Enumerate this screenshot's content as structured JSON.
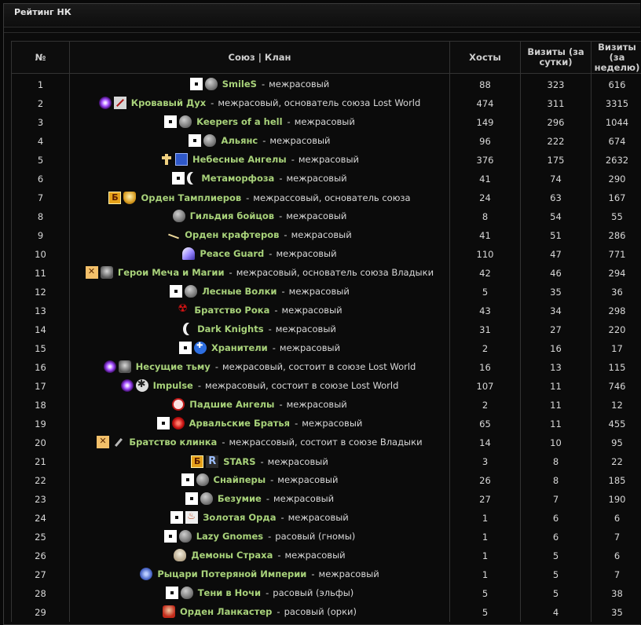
{
  "window": {
    "title": "Рейтинг НК"
  },
  "table": {
    "headers": {
      "num": "№",
      "clan": "Союз | Клан",
      "hosts": "Хосты",
      "visits_day": "Визиты (за сутки)",
      "visits_week": "Визиты (за неделю)"
    },
    "rows": [
      {
        "num": "1",
        "badges": [
          "white-square-icon",
          "stone-icon"
        ],
        "name": "SmileS",
        "desc": "межрасовый",
        "hosts": "88",
        "day": "323",
        "week": "616"
      },
      {
        "num": "2",
        "badges": [
          "purple-orb-icon",
          "sword-icon"
        ],
        "name": "Кровавый Дух",
        "desc": "межрасовый, основатель союза Lost World",
        "hosts": "474",
        "day": "311",
        "week": "3315"
      },
      {
        "num": "3",
        "badges": [
          "white-square-icon",
          "stone-icon"
        ],
        "name": "Keepers of a hell",
        "desc": "межрасовый",
        "hosts": "149",
        "day": "296",
        "week": "1044"
      },
      {
        "num": "4",
        "badges": [
          "white-square-icon",
          "stone-icon"
        ],
        "name": "Альянс",
        "desc": "межрасовый",
        "hosts": "96",
        "day": "222",
        "week": "674"
      },
      {
        "num": "5",
        "badges": [
          "cross-icon",
          "blue-emblem-icon"
        ],
        "name": "Небесные Ангелы",
        "desc": "межрасовый",
        "hosts": "376",
        "day": "175",
        "week": "2632"
      },
      {
        "num": "6",
        "badges": [
          "white-square-icon",
          "moon-icon"
        ],
        "name": "Метаморфоза",
        "desc": "межрасовый",
        "hosts": "41",
        "day": "74",
        "week": "290"
      },
      {
        "num": "7",
        "badges": [
          "gold-b-icon",
          "shield-icon"
        ],
        "name": "Орден Тамплиеров",
        "desc": "межрассовый, основатель союза",
        "hosts": "24",
        "day": "63",
        "week": "167"
      },
      {
        "num": "8",
        "badges": [
          "stone-icon"
        ],
        "name": "Гильдия бойцов",
        "desc": "межрасовый",
        "hosts": "8",
        "day": "54",
        "week": "55"
      },
      {
        "num": "9",
        "badges": [
          "blade-icon"
        ],
        "name": "Орден крафтеров",
        "desc": "межрасовый",
        "hosts": "41",
        "day": "51",
        "week": "286"
      },
      {
        "num": "10",
        "badges": [
          "wing-icon"
        ],
        "name": "Peace Guard",
        "desc": "межрасовый",
        "hosts": "110",
        "day": "47",
        "week": "771"
      },
      {
        "num": "11",
        "badges": [
          "orange-x-icon",
          "beast-icon"
        ],
        "name": "Герои Меча и Магии",
        "desc": "межрасовый, основатель союза Владыки",
        "hosts": "42",
        "day": "46",
        "week": "294"
      },
      {
        "num": "12",
        "badges": [
          "white-square-icon",
          "stone-icon"
        ],
        "name": "Лесные Волки",
        "desc": "межрасовый",
        "hosts": "5",
        "day": "35",
        "week": "36"
      },
      {
        "num": "13",
        "badges": [
          "red-star-icon"
        ],
        "name": "Братство Рока",
        "desc": "межрасовый",
        "hosts": "43",
        "day": "34",
        "week": "298"
      },
      {
        "num": "14",
        "badges": [
          "moon-icon"
        ],
        "name": "Dark Knights",
        "desc": "межрасовый",
        "hosts": "31",
        "day": "27",
        "week": "220"
      },
      {
        "num": "15",
        "badges": [
          "white-square-icon",
          "blue-cross-icon"
        ],
        "name": "Хранители",
        "desc": "межрасовый",
        "hosts": "2",
        "day": "16",
        "week": "17"
      },
      {
        "num": "16",
        "badges": [
          "purple-orb-icon",
          "beast-icon"
        ],
        "name": "Несущие тьму",
        "desc": "межрасовый, состоит в союзе Lost World",
        "hosts": "16",
        "day": "13",
        "week": "115"
      },
      {
        "num": "17",
        "badges": [
          "purple-orb-icon",
          "chaos-icon"
        ],
        "name": "Impulse",
        "desc": "межрасовый, состоит в союзе Lost World",
        "hosts": "107",
        "day": "11",
        "week": "746"
      },
      {
        "num": "18",
        "badges": [
          "red-circle-icon"
        ],
        "name": "Падшие Ангелы",
        "desc": "межрасовый",
        "hosts": "2",
        "day": "11",
        "week": "12"
      },
      {
        "num": "19",
        "badges": [
          "white-square-icon",
          "red-orb-icon"
        ],
        "name": "Арвальские Братья",
        "desc": "межрасовый",
        "hosts": "65",
        "day": "11",
        "week": "455"
      },
      {
        "num": "20",
        "badges": [
          "orange-x-icon",
          "knife-icon"
        ],
        "name": "Братство клинка",
        "desc": "межрассовый, состоит в союзе Владыки",
        "hosts": "14",
        "day": "10",
        "week": "95"
      },
      {
        "num": "21",
        "badges": [
          "gold-b-icon",
          "r-letter-icon"
        ],
        "name": "STARS",
        "desc": "межрасовый",
        "hosts": "3",
        "day": "8",
        "week": "22"
      },
      {
        "num": "22",
        "badges": [
          "white-square-icon",
          "stone-icon"
        ],
        "name": "Снайперы",
        "desc": "межрасовый",
        "hosts": "26",
        "day": "8",
        "week": "185"
      },
      {
        "num": "23",
        "badges": [
          "white-square-icon",
          "stone-icon"
        ],
        "name": "Безумие",
        "desc": "межрасовый",
        "hosts": "27",
        "day": "7",
        "week": "190"
      },
      {
        "num": "24",
        "badges": [
          "white-square-icon",
          "flame-icon"
        ],
        "name": "Золотая Орда",
        "desc": "межрасовый",
        "hosts": "1",
        "day": "6",
        "week": "6"
      },
      {
        "num": "25",
        "badges": [
          "white-square-icon",
          "stone-icon"
        ],
        "name": "Lazy Gnomes",
        "desc": "расовый (гномы)",
        "hosts": "1",
        "day": "6",
        "week": "7"
      },
      {
        "num": "26",
        "badges": [
          "skull-icon"
        ],
        "name": "Демоны Страха",
        "desc": "межрасовый",
        "hosts": "1",
        "day": "5",
        "week": "6"
      },
      {
        "num": "27",
        "badges": [
          "light-blue-orb-icon"
        ],
        "name": "Рыцари Потеряной Империи",
        "desc": "межрасовый",
        "hosts": "1",
        "day": "5",
        "week": "7"
      },
      {
        "num": "28",
        "badges": [
          "white-square-icon",
          "stone-icon"
        ],
        "name": "Тени в Ночи",
        "desc": "расовый (эльфы)",
        "hosts": "5",
        "day": "5",
        "week": "38"
      },
      {
        "num": "29",
        "badges": [
          "orc-icon"
        ],
        "name": "Орден Ланкастер",
        "desc": "расовый (орки)",
        "hosts": "5",
        "day": "4",
        "week": "35"
      }
    ]
  },
  "colors": {
    "background": "#080808",
    "link": "#a8d27a",
    "text": "#d8d8d8",
    "border": "#333333"
  }
}
